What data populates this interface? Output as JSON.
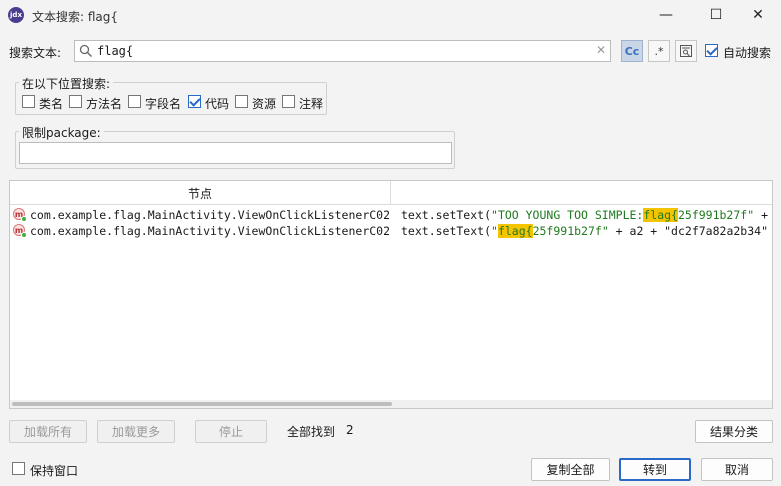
{
  "window": {
    "title": "文本搜索: flag{",
    "app_icon_text": "jdx",
    "minimize_glyph": "—",
    "maximize_glyph": "☐",
    "close_glyph": "✕"
  },
  "search": {
    "label": "搜索文本:",
    "value": "flag{",
    "clear_glyph": "✕",
    "case_sensitive_label": "Cc",
    "regex_label": ".*",
    "auto_search_label": "自动搜索",
    "auto_search_checked": true
  },
  "scope": {
    "title": "在以下位置搜索:",
    "options": [
      {
        "label": "类名",
        "checked": false
      },
      {
        "label": "方法名",
        "checked": false
      },
      {
        "label": "字段名",
        "checked": false
      },
      {
        "label": "代码",
        "checked": true
      },
      {
        "label": "资源",
        "checked": false
      },
      {
        "label": "注释",
        "checked": false
      }
    ]
  },
  "package_filter": {
    "title": "限制package:",
    "value": ""
  },
  "results": {
    "column_node": "节点",
    "column_code": "",
    "rows": [
      {
        "icon": "m",
        "node": "com.example.flag.MainActivity.ViewOnClickListenerC02",
        "code_pre": "text.setText(",
        "code_str_pre": "\"TOO YOUNG TOO SIMPLE:",
        "code_match": "flag{",
        "code_str_post": "25f991b27f\"",
        "code_post": " + "
      },
      {
        "icon": "m",
        "node": "com.example.flag.MainActivity.ViewOnClickListenerC02",
        "code_pre": "text.setText(",
        "code_str_pre": "\"",
        "code_match": "flag{",
        "code_str_post": "25f991b27f\"",
        "code_post": " + a2 + \"dc2f7a82a2b34\""
      }
    ]
  },
  "footer": {
    "load_all": "加载所有",
    "load_more": "加载更多",
    "stop": "停止",
    "found_text": "全部找到",
    "found_count": "2",
    "group_results": "结果分类",
    "keep_window": "保持窗口",
    "keep_window_checked": false,
    "copy_all": "复制全部",
    "goto": "转到",
    "cancel": "取消"
  },
  "colors": {
    "highlight": "#f5c400",
    "string": "#1f7a1f",
    "accent": "#2a69c7"
  }
}
